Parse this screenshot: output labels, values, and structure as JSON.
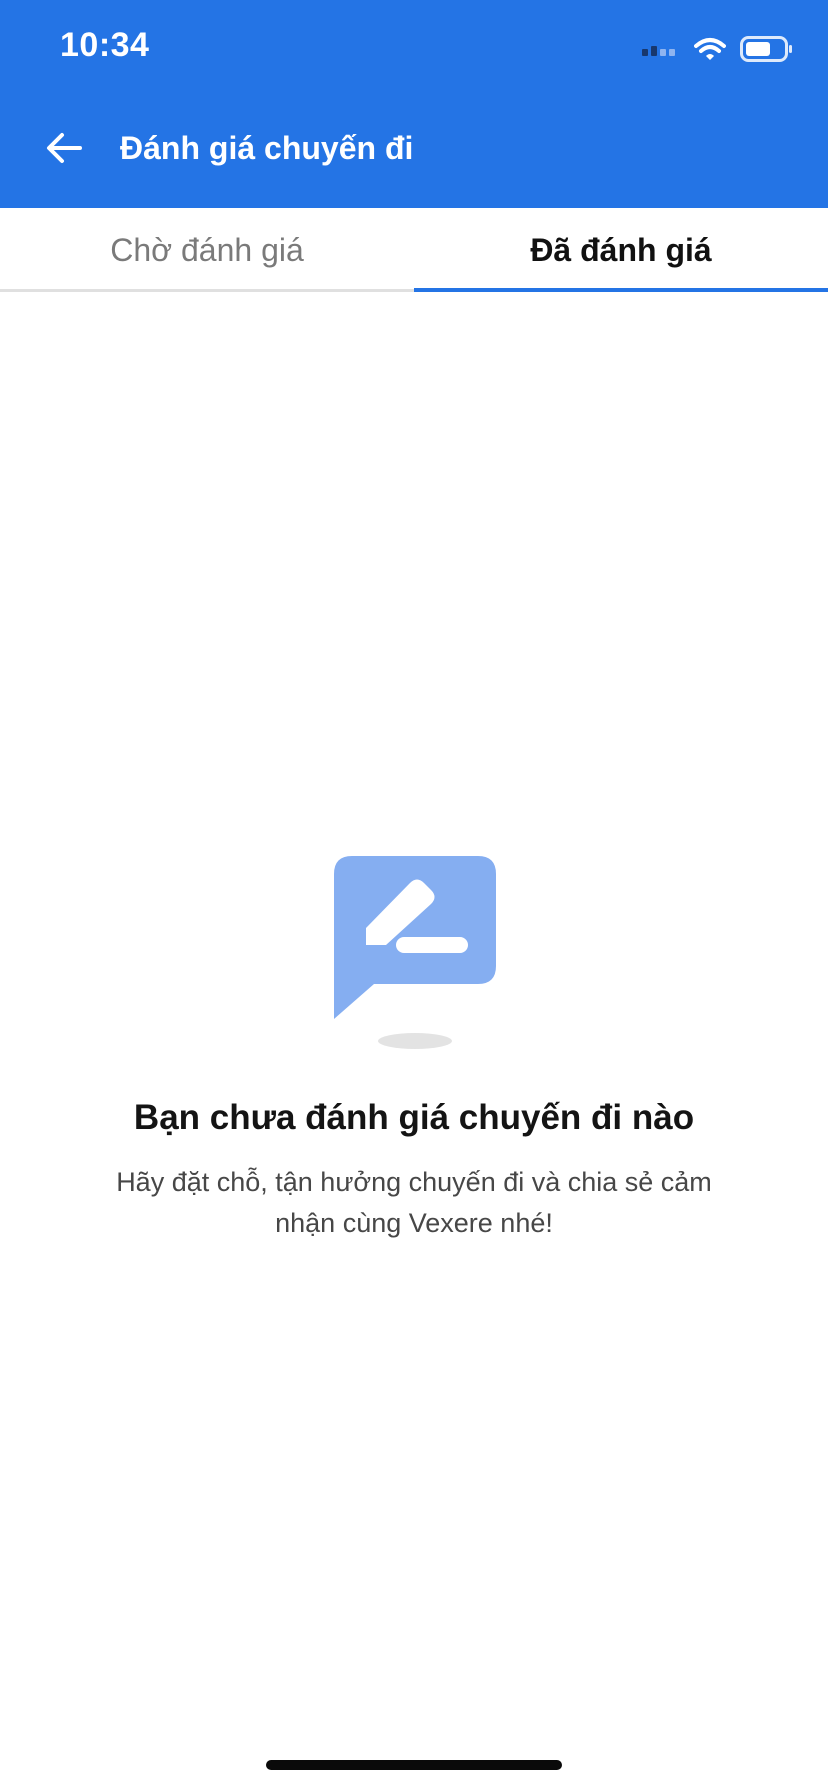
{
  "status_bar": {
    "time": "10:34"
  },
  "header": {
    "title": "Đánh giá chuyến đi",
    "back_icon": "arrow-left-icon",
    "background_color": "#2474E5"
  },
  "tabs": [
    {
      "label": "Chờ đánh giá",
      "active": false
    },
    {
      "label": "Đã đánh giá",
      "active": true
    }
  ],
  "empty_state": {
    "icon": "edit-comment-icon",
    "title": "Bạn chưa đánh giá chuyến đi nào",
    "description": "Hãy đặt chỗ, tận hưởng chuyến đi và chia sẻ cảm nhận cùng Vexere nhé!"
  },
  "colors": {
    "accent": "#2474E5",
    "illustration": "#85AEF1",
    "inactive_tab": "#7A7A7A"
  }
}
